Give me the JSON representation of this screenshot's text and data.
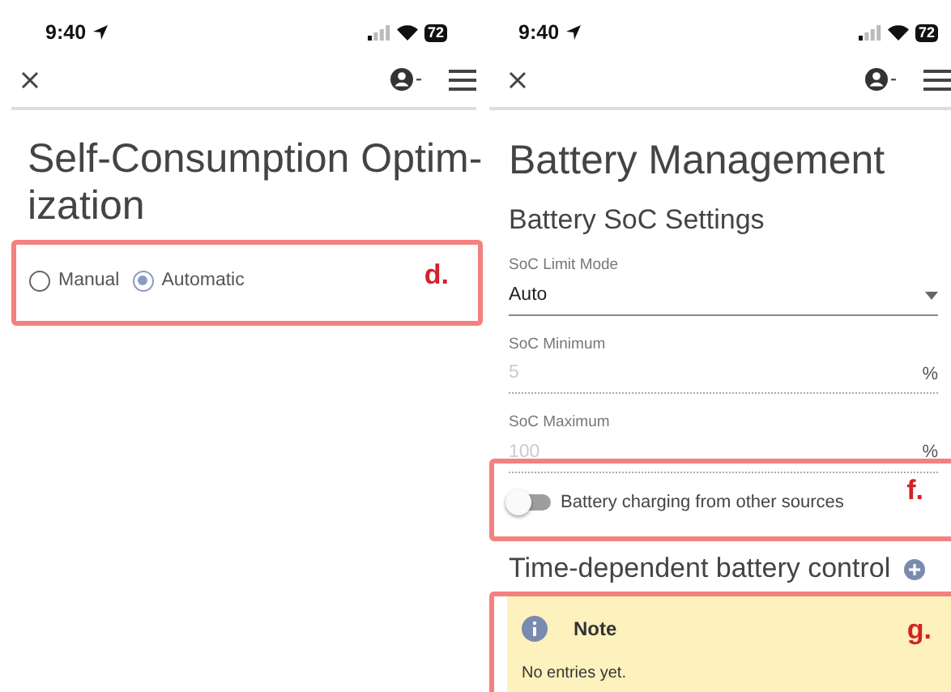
{
  "status_bars": [
    {
      "time": "9:40",
      "battery": "72"
    },
    {
      "time": "9:40",
      "battery": "72"
    }
  ],
  "screens": [
    {
      "title": "Self-Consumption Optim-\nization",
      "radios": [
        {
          "label": "Manual",
          "selected": false
        },
        {
          "label": "Automatic",
          "selected": true
        }
      ]
    },
    {
      "title": "Battery Management",
      "section_title": "Battery SoC Settings",
      "select": {
        "label": "SoC Limit Mode",
        "value": "Auto"
      },
      "number_fields": [
        {
          "label": "SoC Minimum",
          "placeholder": "5",
          "unit": "%"
        },
        {
          "label": "SoC Maximum",
          "placeholder": "100",
          "unit": "%"
        }
      ],
      "toggle": {
        "label": "Battery charging from other sources",
        "on": false
      },
      "section2_title": "Time-dependent battery control",
      "note": {
        "title": "Note",
        "text": "No entries yet."
      }
    }
  ],
  "annotations": [
    {
      "label": "d."
    },
    {
      "label": "f."
    },
    {
      "label": "g."
    }
  ]
}
